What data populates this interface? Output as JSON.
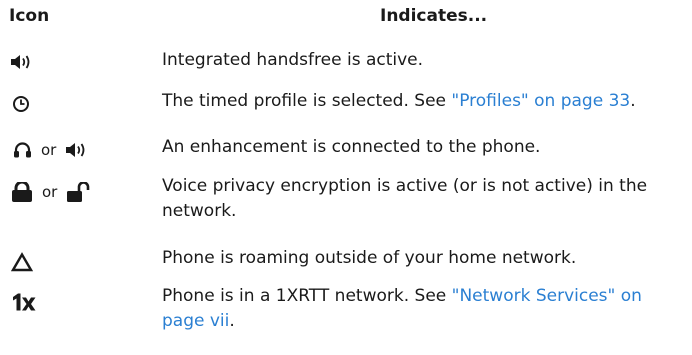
{
  "header": {
    "icon_col": "Icon",
    "desc_col": "Indicates..."
  },
  "rows": [
    {
      "icons": [
        "speaker-icon"
      ],
      "text": "Integrated handsfree is active."
    },
    {
      "icons": [
        "clock-icon"
      ],
      "text": "The timed profile is selected. See ",
      "link": "\"Profiles\" on page 33",
      "after": "."
    },
    {
      "icons": [
        "headset-icon",
        "speaker-icon"
      ],
      "or": "or",
      "text": "An enhancement is connected to the phone."
    },
    {
      "icons": [
        "lock-closed-icon",
        "lock-open-icon"
      ],
      "or": "or",
      "text": "Voice privacy encryption is active (or is not active) in the network."
    },
    {
      "icons": [
        "roaming-triangle-icon"
      ],
      "text": "Phone is roaming outside of your home network."
    },
    {
      "icons": [
        "1x-icon"
      ],
      "text": "Phone is in a 1XRTT network. See ",
      "link": "\"Network Services\" on page vii",
      "after": "."
    }
  ],
  "colors": {
    "text": "#1a1a1a",
    "link": "#2a7fd2"
  }
}
